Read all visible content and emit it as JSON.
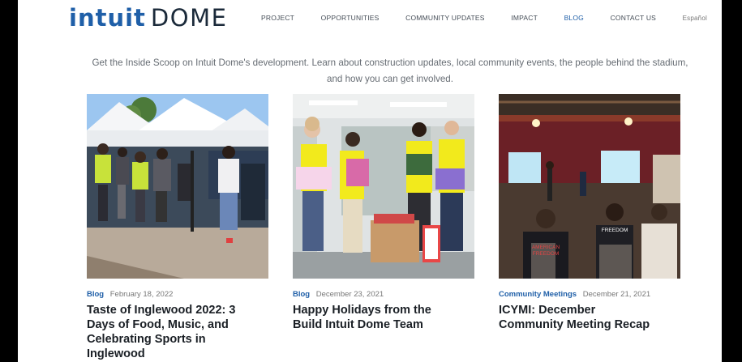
{
  "brand": {
    "word1": "intuit",
    "word2": "DOME"
  },
  "nav": [
    {
      "label": "PROJECT"
    },
    {
      "label": "OPPORTUNITIES"
    },
    {
      "label": "COMMUNITY UPDATES"
    },
    {
      "label": "IMPACT"
    },
    {
      "label": "BLOG",
      "active": true
    },
    {
      "label": "CONTACT US"
    },
    {
      "label": "Español"
    }
  ],
  "intro": {
    "line1": "Get the Inside Scoop on Intuit Dome's development. Learn about construction updates, local community events, the people behind the stadium,",
    "line2": "and how you can get involved."
  },
  "posts": [
    {
      "category": "Blog",
      "date": "February 18, 2022",
      "title": "Taste of Inglewood 2022: 3 Days of Food, Music, and Celebrating Sports in Inglewood"
    },
    {
      "category": "Blog",
      "date": "December 23, 2021",
      "title": "Happy Holidays from the Build Intuit Dome Team"
    },
    {
      "category": "Community Meetings",
      "date": "December 21, 2021",
      "title": "ICYMI: December Community Meeting Recap"
    }
  ],
  "photo_text": {
    "shirt_word1": "AMERICAN",
    "shirt_word2": "FREEDOM"
  },
  "colors": {
    "brand_blue": "#1f5fa8",
    "text_dark": "#1a1f25",
    "background": "#ffffff",
    "frame": "#000000"
  }
}
